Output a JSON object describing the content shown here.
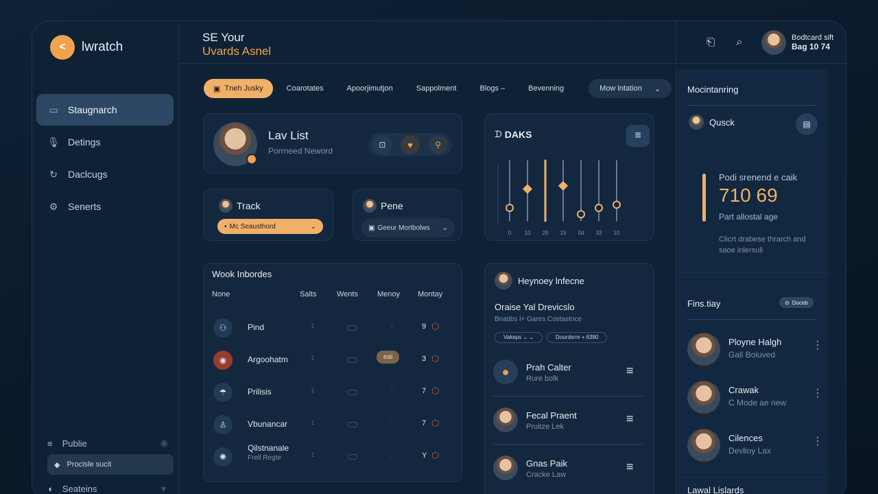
{
  "app": {
    "name": "lwratch"
  },
  "colors": {
    "accent": "#f0a24f",
    "bg": "#0f2235",
    "card": "#13283e"
  },
  "sidebar": {
    "items": [
      {
        "label": "Staugnarch",
        "icon": "monitor-icon",
        "active": true
      },
      {
        "label": "Detings",
        "icon": "mic-icon"
      },
      {
        "label": "Daclcugs",
        "icon": "refresh-icon"
      },
      {
        "label": "Senerts",
        "icon": "gear-icon"
      }
    ],
    "bottom": {
      "top_label": "Publie",
      "button_label": "Procisle sucit",
      "last_label": "Seateins"
    }
  },
  "header": {
    "line1": "SE Your",
    "line2": "Uvards Asnel"
  },
  "user": {
    "line1": "Bodtcard sift",
    "line2": "Bag 10 74"
  },
  "tabs": [
    "Tneh Jusky",
    "Coarotates",
    "Apoorjimutjon",
    "Sappolment",
    "Blogs –",
    "Bevenning"
  ],
  "more_tab": {
    "label": "Mow lntation"
  },
  "profile_card": {
    "title": "Lav List",
    "subtitle": "Porrneed Neword"
  },
  "track_card": {
    "title": "Track",
    "select": "Mc Seausthord"
  },
  "pene_card": {
    "title": "Pene",
    "select": "Geeur Mortbolws"
  },
  "daks": {
    "title": "DAKS",
    "chart_data": {
      "type": "scatter",
      "x": [
        "0",
        "10",
        "20",
        "15",
        "0d",
        "33",
        "10"
      ],
      "values": [
        0.25,
        0.55,
        0.85,
        0.6,
        0.15,
        0.25,
        0.3
      ],
      "xlabel": "",
      "ylabel": ""
    }
  },
  "work": {
    "title": "Wook Inbordes",
    "columns": [
      "None",
      "Salts",
      "Wents",
      "Menoy",
      "Montay"
    ],
    "rows": [
      {
        "name": "Pind",
        "sub": "",
        "c1": "1",
        "c2": "",
        "c3": "::",
        "c4": "9"
      },
      {
        "name": "Argoohatm",
        "sub": "",
        "c1": "1",
        "c2": "",
        "c3": "eai",
        "c4": "3"
      },
      {
        "name": "Prilisis",
        "sub": "",
        "c1": "1",
        "c2": "",
        "c3": "::",
        "c4": "7"
      },
      {
        "name": "Vbunancar",
        "sub": "",
        "c1": "1",
        "c2": "",
        "c3": "::",
        "c4": "7"
      },
      {
        "name": "Qilstnanale",
        "sub": "Frell Regte",
        "c1": "1",
        "c2": "",
        "c3": "::",
        "c4": "Y"
      }
    ]
  },
  "hey": {
    "title": "Heynoey lnfecne",
    "sub_title": "Oraise Yal Drevicslo",
    "sub_text": "Bnatibs l+ Gares Costastnce",
    "chip1": "Vakeps ⌄ ⌄",
    "chip2": "Dourdsrre + 6380",
    "people": [
      {
        "name": "Prah Calter",
        "sub": "Rure bolk"
      },
      {
        "name": "Fecal Praent",
        "sub": "Pruitze Lek"
      },
      {
        "name": "Gnas Paik",
        "sub": "Cracke Law"
      }
    ]
  },
  "right": {
    "title": "Mocintanring",
    "quick": "Qusck",
    "stat_label": "Podi srenend e caik",
    "stat_value": "710 69",
    "stat_sub": "Part allostal age",
    "note": "Clicrt drabese thrarch and saoe inlersuli",
    "fins_title": "Fins.tiay",
    "fins_button": "Doceb",
    "people": [
      {
        "name": "Ployne Halgh",
        "sub": "Gall Boiuved"
      },
      {
        "name": "Crawak",
        "sub": "C Mode ae riew"
      },
      {
        "name": "Cilences",
        "sub": "Devlioy Lax"
      }
    ],
    "footer": "Lawal Lislards"
  }
}
